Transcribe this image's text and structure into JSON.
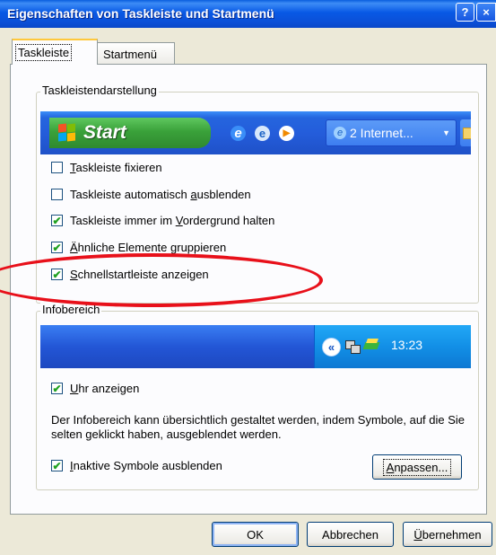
{
  "window": {
    "title": "Eigenschaften von Taskleiste und Startmenü",
    "help_label": "?",
    "close_label": "×"
  },
  "tabs": [
    {
      "label": "Taskleiste",
      "active": true
    },
    {
      "label": "Startmenü",
      "active": false
    }
  ],
  "taskbar_group": {
    "label": "Taskleistendarstellung",
    "preview": {
      "start_label": "Start",
      "task_button_label": "2 Internet..."
    },
    "options": [
      {
        "label": "Taskleiste fixieren",
        "mnemonic": "T",
        "rest": "askleiste fixieren",
        "checked": false
      },
      {
        "label": "Taskleiste automatisch ausblenden",
        "pre": "Taskleiste automatisch ",
        "mnemonic": "a",
        "rest": "usblenden",
        "checked": false
      },
      {
        "label": "Taskleiste immer im Vordergrund halten",
        "pre": "Taskleiste immer im ",
        "mnemonic": "V",
        "rest": "ordergrund halten",
        "checked": true
      },
      {
        "label": "Ähnliche Elemente gruppieren",
        "mnemonic": "Ä",
        "rest": "hnliche Elemente gruppieren",
        "checked": true
      },
      {
        "label": "Schnellstartleiste anzeigen",
        "mnemonic": "S",
        "rest": "chnellstartleiste anzeigen",
        "checked": true
      }
    ]
  },
  "notify_group": {
    "label": "Infobereich",
    "preview": {
      "chevron": "«",
      "clock": "13:23"
    },
    "clock_option": {
      "label": "Uhr anzeigen",
      "mnemonic": "U",
      "rest": "hr anzeigen",
      "checked": true
    },
    "description": "Der Infobereich kann übersichtlich gestaltet werden, indem Symbole, auf die Sie selten geklickt haben, ausgeblendet werden.",
    "inactive_option": {
      "label": "Inaktive Symbole ausblenden",
      "mnemonic": "I",
      "rest": "naktive Symbole ausblenden",
      "checked": true
    },
    "customize_button": {
      "label": "Anpassen...",
      "mnemonic": "A",
      "rest": "npassen..."
    }
  },
  "footer": {
    "ok": "OK",
    "cancel": "Abbrechen",
    "apply": {
      "label": "Übernehmen",
      "mnemonic": "Ü",
      "rest": "bernehmen"
    }
  },
  "colors": {
    "titlebar": "#0859e5",
    "highlight_ellipse": "#e8101a",
    "checkmark": "#21a121"
  },
  "icons": [
    "windows-logo-icon",
    "internet-explorer-icon",
    "outlook-express-icon",
    "media-player-icon",
    "folder-icon",
    "chevron-left-icon",
    "network-icon",
    "security-icon"
  ]
}
